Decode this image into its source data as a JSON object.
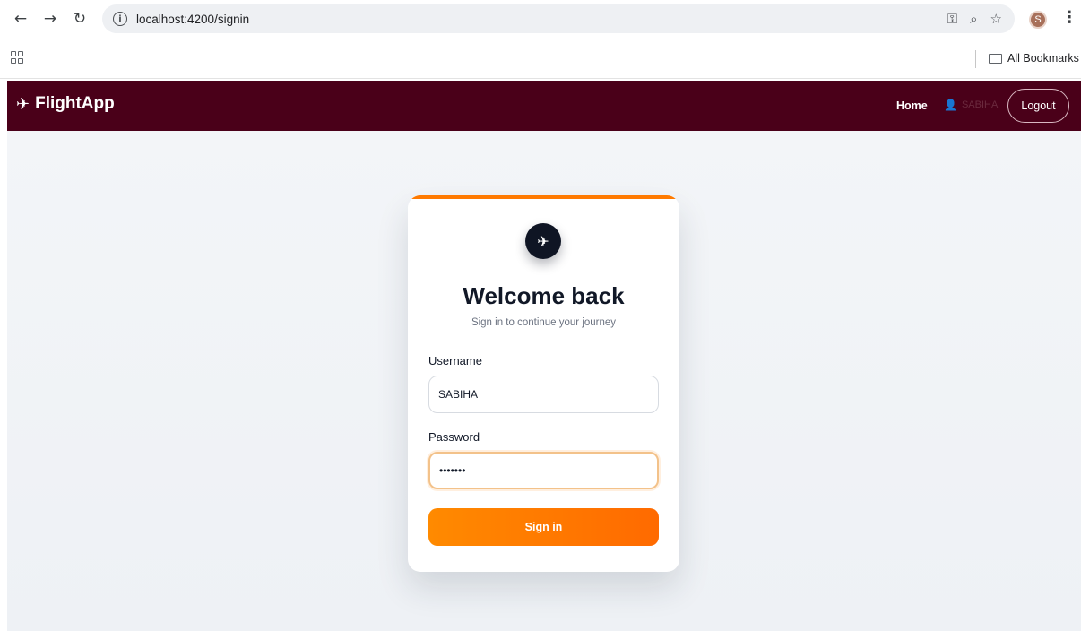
{
  "browser": {
    "url": "localhost:4200/signin",
    "bookmarks_label": "All Bookmarks",
    "profile_initial": "S",
    "icons": [
      "back-arrow-icon",
      "forward-arrow-icon",
      "reload-icon",
      "info-icon",
      "key-icon",
      "zoom-icon",
      "star-icon",
      "kebab-menu-icon",
      "apps-grid-icon",
      "folder-icon"
    ]
  },
  "navbar": {
    "brand": "FlightApp",
    "home": "Home",
    "user": "SABIHA",
    "logout": "Logout",
    "background_color": "#4a0019"
  },
  "card": {
    "title": "Welcome back",
    "subtitle": "Sign in to continue your journey",
    "username_label": "Username",
    "username_value": "SABIHA",
    "password_label": "Password",
    "password_value": "•••••••",
    "signin_label": "Sign in",
    "accent_color": "#ff7a00"
  }
}
